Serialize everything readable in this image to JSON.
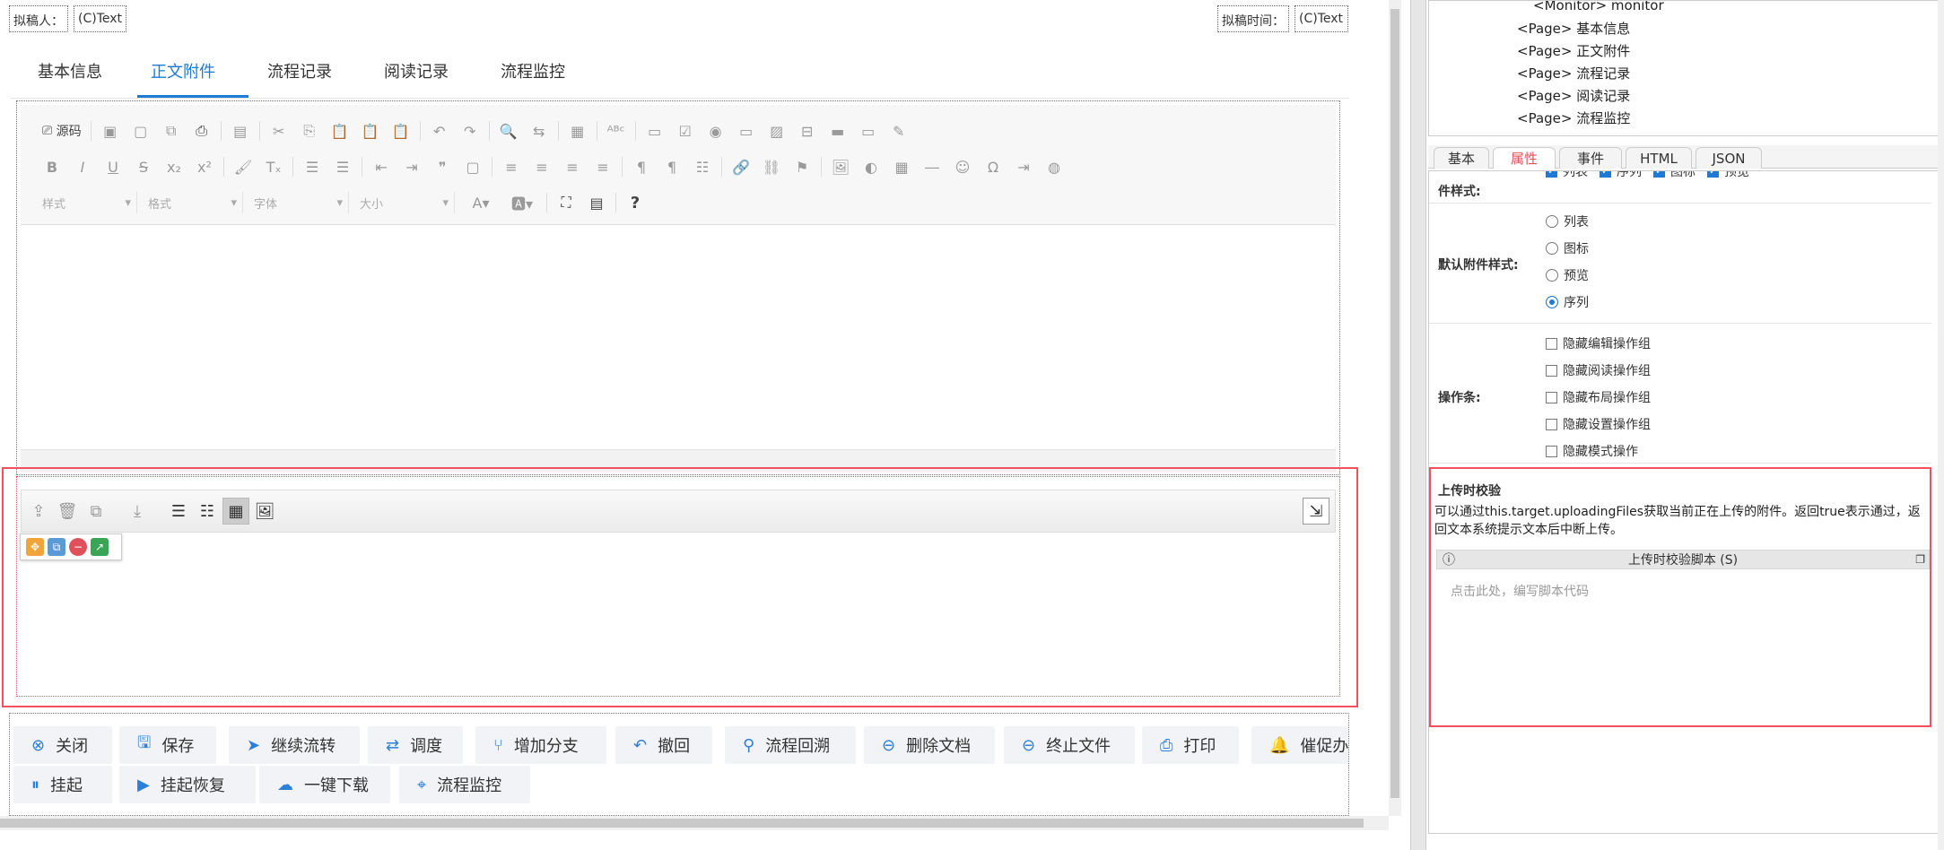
{
  "header": {
    "drafter_label": "拟稿人：",
    "drafter_value": "(C)Text",
    "draft_time_label": "拟稿时间：",
    "draft_time_value": "(C)Text"
  },
  "tabs": [
    {
      "label": "基本信息",
      "active": false
    },
    {
      "label": "正文附件",
      "active": true
    },
    {
      "label": "流程记录",
      "active": false
    },
    {
      "label": "阅读记录",
      "active": false
    },
    {
      "label": "流程监控",
      "active": false
    }
  ],
  "editor": {
    "source_label": "源码",
    "style_combo": "样式",
    "format_combo": "格式",
    "font_combo": "字体",
    "size_combo": "大小",
    "help_label": "?"
  },
  "actions": {
    "row1": [
      {
        "label": "关闭",
        "icon": "close-icon",
        "glyph": "⊗"
      },
      {
        "label": "保存",
        "icon": "save-icon",
        "glyph": "🖫"
      },
      {
        "label": "继续流转",
        "icon": "send-icon",
        "glyph": "➤"
      },
      {
        "label": "调度",
        "icon": "dispatch-icon",
        "glyph": "⇄"
      },
      {
        "label": "增加分支",
        "icon": "branch-icon",
        "glyph": "⑂"
      },
      {
        "label": "撤回",
        "icon": "undo-icon",
        "glyph": "↶"
      },
      {
        "label": "流程回溯",
        "icon": "trace-icon",
        "glyph": "⚲"
      },
      {
        "label": "删除文档",
        "icon": "delete-doc-icon",
        "glyph": "⊖"
      },
      {
        "label": "终止文件",
        "icon": "terminate-icon",
        "glyph": "⊖"
      },
      {
        "label": "打印",
        "icon": "print-icon",
        "glyph": "⎙"
      },
      {
        "label": "催促办理",
        "icon": "bell-icon",
        "glyph": "🔔"
      }
    ],
    "row2": [
      {
        "label": "挂起",
        "icon": "pause-icon",
        "glyph": "⏸"
      },
      {
        "label": "挂起恢复",
        "icon": "resume-icon",
        "glyph": "▶"
      },
      {
        "label": "一键下载",
        "icon": "download-icon",
        "glyph": "☁"
      },
      {
        "label": "流程监控",
        "icon": "monitor-icon",
        "glyph": "⌖"
      }
    ]
  },
  "tree": {
    "items": [
      "<Monitor> monitor",
      "<Page> 基本信息",
      "<Page> 正文附件",
      "<Page> 流程记录",
      "<Page> 阅读记录",
      "<Page> 流程监控"
    ]
  },
  "panel_tabs": [
    {
      "label": "基本",
      "active": false
    },
    {
      "label": "属性",
      "active": true
    },
    {
      "label": "事件",
      "active": false
    },
    {
      "label": "HTML",
      "active": false
    },
    {
      "label": "JSON",
      "active": false
    }
  ],
  "props": {
    "attach_style_label": "件样式:",
    "attach_style_options": [
      {
        "label": "列表",
        "checked": true
      },
      {
        "label": "序列",
        "checked": true
      },
      {
        "label": "图标",
        "checked": true
      },
      {
        "label": "预览",
        "checked": true
      }
    ],
    "default_style_label": "默认附件样式:",
    "default_style_options": [
      {
        "label": "列表",
        "checked": false
      },
      {
        "label": "图标",
        "checked": false
      },
      {
        "label": "预览",
        "checked": false
      },
      {
        "label": "序列",
        "checked": true
      }
    ],
    "toolbar_label": "操作条:",
    "toolbar_options": [
      {
        "label": "隐藏编辑操作组",
        "checked": false
      },
      {
        "label": "隐藏阅读操作组",
        "checked": false
      },
      {
        "label": "隐藏布局操作组",
        "checked": false
      },
      {
        "label": "隐藏设置操作组",
        "checked": false
      },
      {
        "label": "隐藏模式操作",
        "checked": false
      }
    ],
    "upload_title": "上传时校验",
    "upload_desc": "可以通过this.target.uploadingFiles获取当前正在上传的附件。返回true表示通过，返回文本系统提示文本后中断上传。",
    "script_title": "上传时校验脚本 (S)",
    "script_placeholder": "点击此处，编写脚本代码"
  },
  "colors": {
    "accent": "#1f7ad6",
    "highlight_border": "#f0505f",
    "active_tab_text": "#e0505a"
  }
}
